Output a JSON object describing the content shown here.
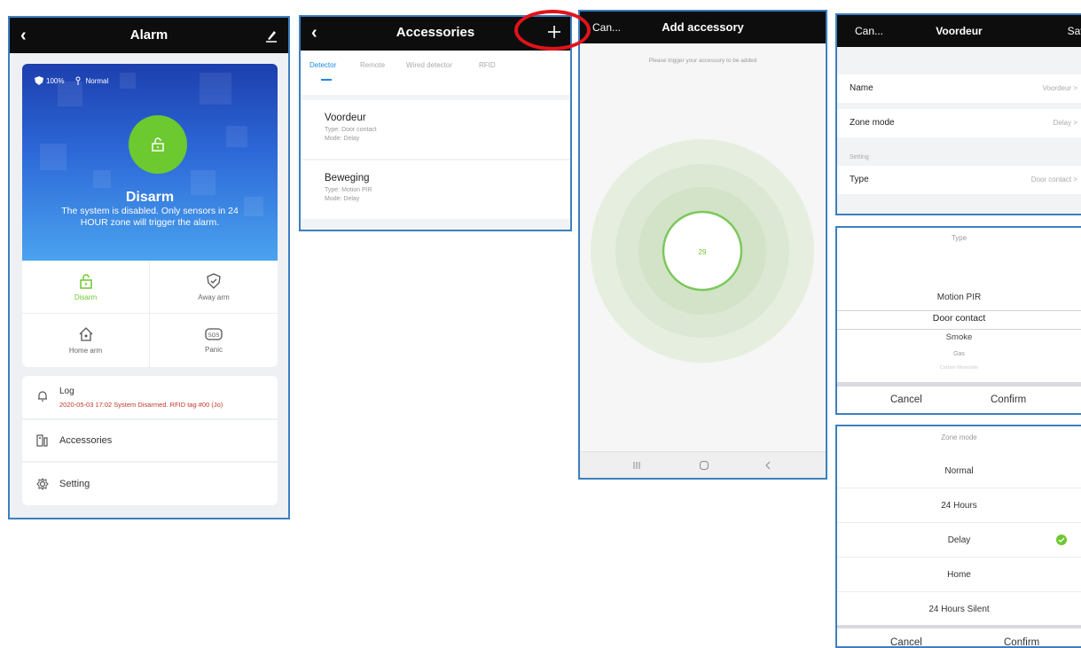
{
  "alarm_screen": {
    "title": "Alarm",
    "battery": "100%",
    "signal": "Normal",
    "status_title": "Disarm",
    "status_desc": "The system is disabled. Only sensors in 24 HOUR zone will trigger the alarm.",
    "modes": [
      "Disarm",
      "Away arm",
      "Home arm",
      "Panic"
    ],
    "log_label": "Log",
    "log_message": "2020-05-03 17:02 System Disarmed.  RFID tag #00 (Jo)",
    "accessories_label": "Accessories",
    "setting_label": "Setting"
  },
  "accessories_screen": {
    "title": "Accessories",
    "tabs": [
      "Detector",
      "Remote",
      "Wired detector",
      "RFID"
    ],
    "items": [
      {
        "name": "Voordeur",
        "type": "Type: Door contact",
        "mode": "Mode: Delay"
      },
      {
        "name": "Beweging",
        "type": "Type: Motion PIR",
        "mode": "Mode: Delay"
      }
    ]
  },
  "add_screen": {
    "cancel": "Can...",
    "title": "Add accessory",
    "hint": "Please trigger your accessory to be added",
    "countdown": "29"
  },
  "detail_screen": {
    "cancel": "Can...",
    "title": "Voordeur",
    "save": "Save",
    "name_label": "Name",
    "name_value": "Voordeur",
    "zone_label": "Zone mode",
    "zone_value": "Delay",
    "section": "Setting",
    "type_label": "Type",
    "type_value": "Door contact"
  },
  "type_picker": {
    "header": "Type",
    "options": [
      "Motion PIR",
      "Door contact",
      "Smoke",
      "Gas",
      "Carbon Monoxide"
    ],
    "cancel": "Cancel",
    "confirm": "Confirm"
  },
  "zone_picker": {
    "header": "Zone mode",
    "options": [
      "Normal",
      "24 Hours",
      "Delay",
      "Home",
      "24 Hours Silent"
    ],
    "cancel": "Cancel",
    "confirm": "Confirm"
  },
  "colors": {
    "accent_green": "#6cc930",
    "accent_blue": "#1e88e5",
    "annotation_red": "#e2131b",
    "panel_border": "#3c7fc1"
  }
}
